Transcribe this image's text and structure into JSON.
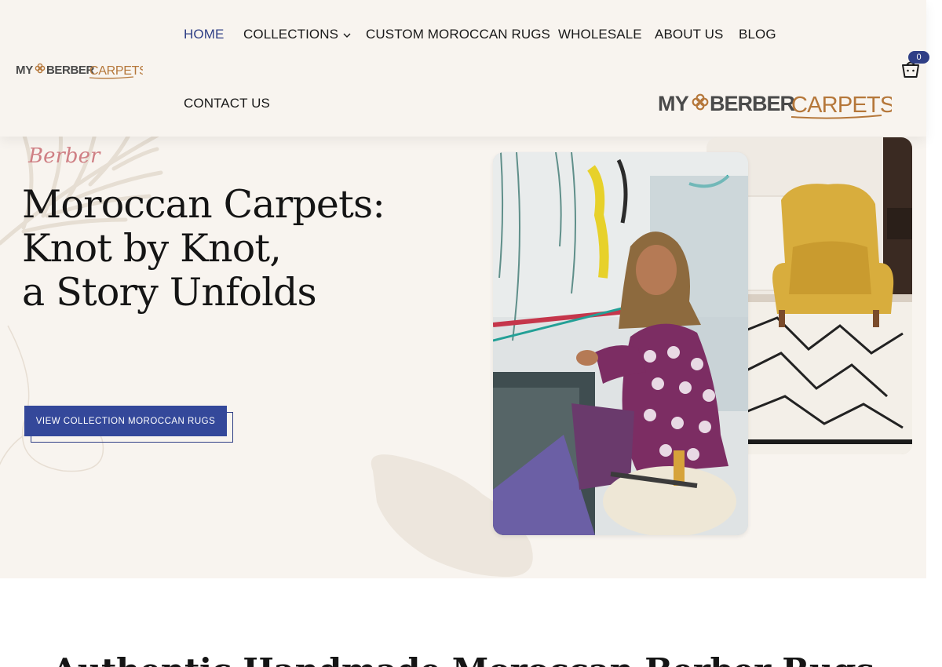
{
  "brand": {
    "logo_text": "MY BERBER CARPETS",
    "colors": {
      "accent": "#2f3f86",
      "button": "#34489a",
      "logo_brown": "#b5773a",
      "logo_gray": "#4a4a4a",
      "eyebrow": "#cf7f84",
      "background": "#f8f4ef"
    }
  },
  "nav": {
    "items": [
      {
        "label": "HOME",
        "active": true
      },
      {
        "label": "COLLECTIONS",
        "icon": "chevron-down-icon"
      },
      {
        "label": "CUSTOM MOROCCAN RUGS"
      },
      {
        "label": "WHOLESALE"
      },
      {
        "label": "ABOUT US"
      },
      {
        "label": "BLOG"
      },
      {
        "label": "CONTACT US"
      }
    ]
  },
  "cart": {
    "count": "0",
    "icon": "cart-icon"
  },
  "hero": {
    "eyebrow": "Berber",
    "title_lines": [
      "Moroccan Carpets:",
      "Knot by Knot,",
      "a Story Unfolds"
    ],
    "cta_label": "VIEW COLLECTION MOROCCAN RUGS",
    "images": [
      "woman-weaving-photo",
      "yellow-armchair-rug-photo"
    ]
  },
  "section": {
    "heading": "Authentic Handmade Moroccan Berber Rugs"
  }
}
